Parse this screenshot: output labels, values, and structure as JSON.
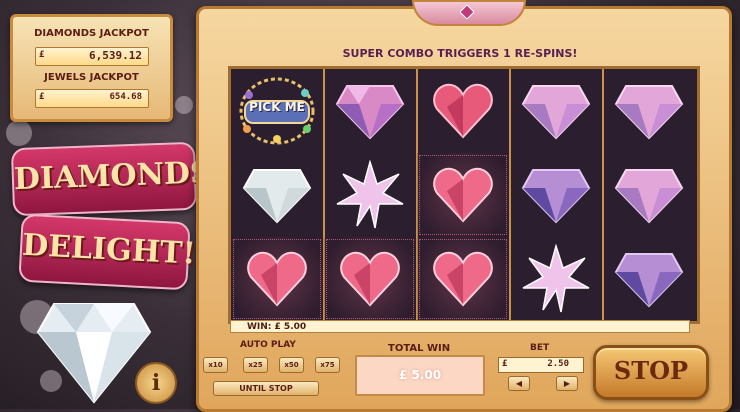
{
  "jackpots": {
    "diamonds": {
      "label": "DIAMONDS JACKPOT",
      "currency": "£",
      "value": "6,539.12"
    },
    "jewels": {
      "label": "JEWELS JACKPOT",
      "currency": "£",
      "value": "654.68"
    }
  },
  "logo": {
    "line1": "DIAMONDS",
    "line2": "DELIGHT!"
  },
  "banner": {
    "text": "SUPER COMBO TRIGGERS 1 RE-SPINS!"
  },
  "bonus": {
    "pick_label": "PICK ME"
  },
  "reels": {
    "grid": [
      [
        "pick-me-bonus",
        "pink-diamond",
        "red-heart-gem",
        "pink-diamond",
        "pink-diamond"
      ],
      [
        "white-diamond",
        "star-gem",
        "red-heart-gem",
        "purple-diamond",
        "pink-diamond"
      ],
      [
        "red-heart-gem",
        "red-heart-gem",
        "red-heart-gem",
        "star-gem",
        "purple-diamond"
      ]
    ]
  },
  "win_line": {
    "text": "WIN: £ 5.00"
  },
  "autoplay": {
    "label": "AUTO PLAY",
    "options": [
      "x10",
      "x25",
      "x50",
      "x75"
    ],
    "until_stop": "UNTIL STOP"
  },
  "total_win": {
    "label": "TOTAL WIN",
    "value": "£ 5.00"
  },
  "bet": {
    "label": "BET",
    "currency": "£",
    "value": "2.50"
  },
  "controls": {
    "stop_label": "STOP",
    "info_label": "i"
  },
  "colors": {
    "frame": "#e9b86c",
    "ribbon": "#b8244f",
    "reel_bg": "#2b1f2f",
    "text": "#5a1d14"
  }
}
